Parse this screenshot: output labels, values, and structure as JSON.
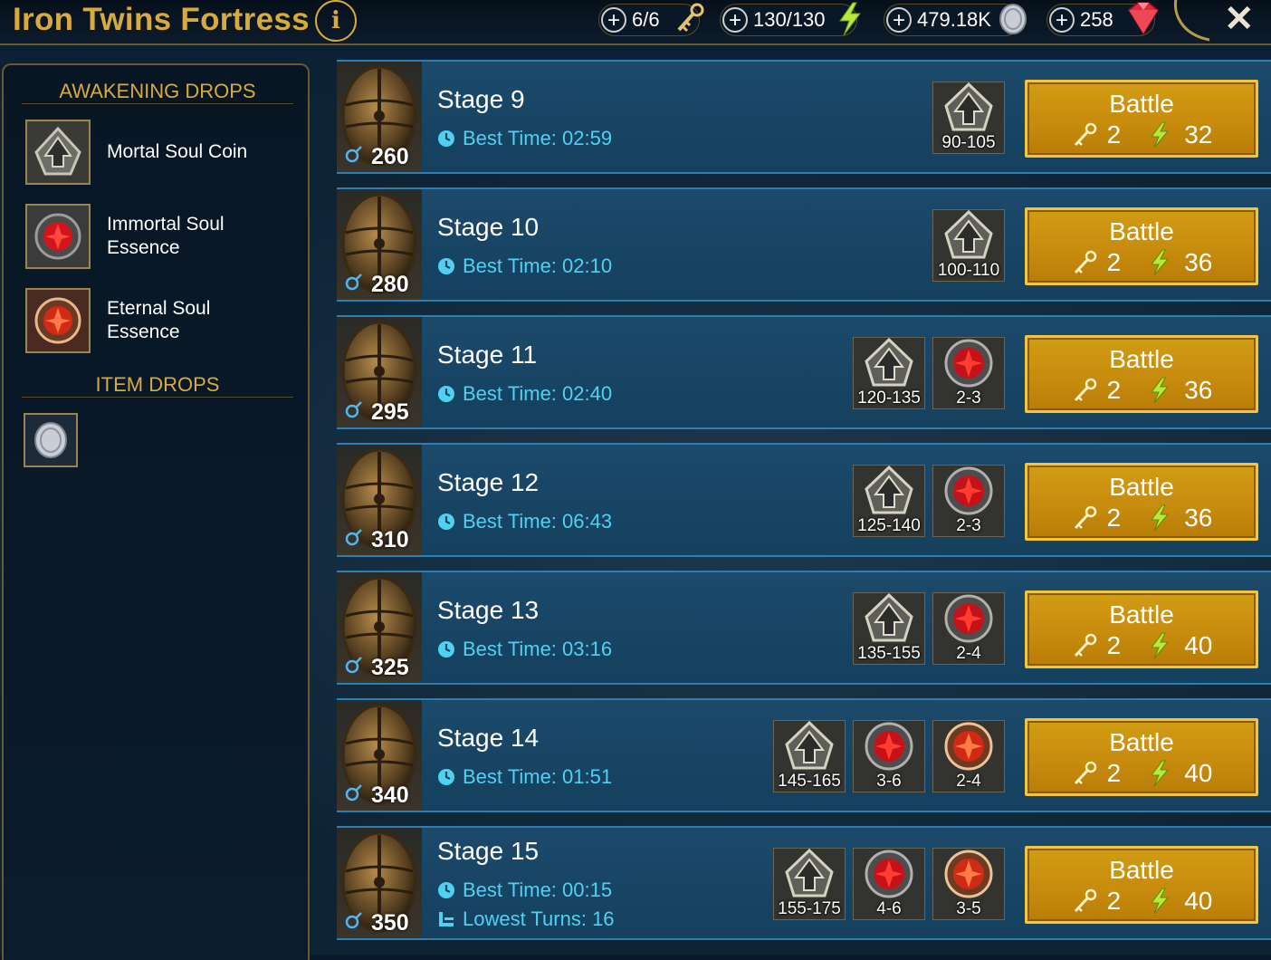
{
  "header": {
    "title": "Iron Twins Fortress",
    "info_icon": "i",
    "resources": [
      {
        "id": "keys",
        "value": "6/6",
        "icon": "key-icon"
      },
      {
        "id": "energy",
        "value": "130/130",
        "icon": "energy-icon"
      },
      {
        "id": "silver",
        "value": "479.18K",
        "icon": "silver-coin-icon"
      },
      {
        "id": "gems",
        "value": "258",
        "icon": "gem-icon"
      }
    ],
    "close_icon": "✕"
  },
  "left_panel": {
    "awakening_title": "AWAKENING DROPS",
    "awakening_items": [
      {
        "label": "Mortal Soul Coin",
        "icon": "mortal-soul-coin-icon"
      },
      {
        "label": "Immortal Soul Essence",
        "icon": "immortal-soul-essence-icon"
      },
      {
        "label": "Eternal Soul Essence",
        "icon": "eternal-soul-essence-icon"
      }
    ],
    "item_title": "ITEM DROPS",
    "item_drops": [
      {
        "icon": "silver-coin-icon"
      }
    ]
  },
  "stages": [
    {
      "name": "Stage 9",
      "power": "260",
      "best_time": "Best Time: 02:59",
      "lowest_turns": "",
      "rewards": [
        {
          "type": "coin",
          "qty": "90-105"
        }
      ],
      "battle": "Battle",
      "keys": "2",
      "energy": "32"
    },
    {
      "name": "Stage 10",
      "power": "280",
      "best_time": "Best Time: 02:10",
      "lowest_turns": "",
      "rewards": [
        {
          "type": "coin",
          "qty": "100-110"
        }
      ],
      "battle": "Battle",
      "keys": "2",
      "energy": "36"
    },
    {
      "name": "Stage 11",
      "power": "295",
      "best_time": "Best Time: 02:40",
      "lowest_turns": "",
      "rewards": [
        {
          "type": "coin",
          "qty": "120-135"
        },
        {
          "type": "immortal",
          "qty": "2-3"
        }
      ],
      "battle": "Battle",
      "keys": "2",
      "energy": "36"
    },
    {
      "name": "Stage 12",
      "power": "310",
      "best_time": "Best Time: 06:43",
      "lowest_turns": "",
      "rewards": [
        {
          "type": "coin",
          "qty": "125-140"
        },
        {
          "type": "immortal",
          "qty": "2-3"
        }
      ],
      "battle": "Battle",
      "keys": "2",
      "energy": "36"
    },
    {
      "name": "Stage 13",
      "power": "325",
      "best_time": "Best Time: 03:16",
      "lowest_turns": "",
      "rewards": [
        {
          "type": "coin",
          "qty": "135-155"
        },
        {
          "type": "immortal",
          "qty": "2-4"
        }
      ],
      "battle": "Battle",
      "keys": "2",
      "energy": "40"
    },
    {
      "name": "Stage 14",
      "power": "340",
      "best_time": "Best Time: 01:51",
      "lowest_turns": "",
      "rewards": [
        {
          "type": "coin",
          "qty": "145-165"
        },
        {
          "type": "immortal",
          "qty": "3-6"
        },
        {
          "type": "eternal",
          "qty": "2-4"
        }
      ],
      "battle": "Battle",
      "keys": "2",
      "energy": "40"
    },
    {
      "name": "Stage 15",
      "power": "350",
      "best_time": "Best Time: 00:15",
      "lowest_turns": "Lowest Turns: 16",
      "rewards": [
        {
          "type": "coin",
          "qty": "155-175"
        },
        {
          "type": "immortal",
          "qty": "4-6"
        },
        {
          "type": "eternal",
          "qty": "3-5"
        }
      ],
      "battle": "Battle",
      "keys": "2",
      "energy": "40"
    }
  ],
  "colors": {
    "gold": "#d8aa3c",
    "time_blue": "#4fd1f2",
    "battle_gold": "#c98d0e",
    "stage_bg": "#1a4666"
  }
}
